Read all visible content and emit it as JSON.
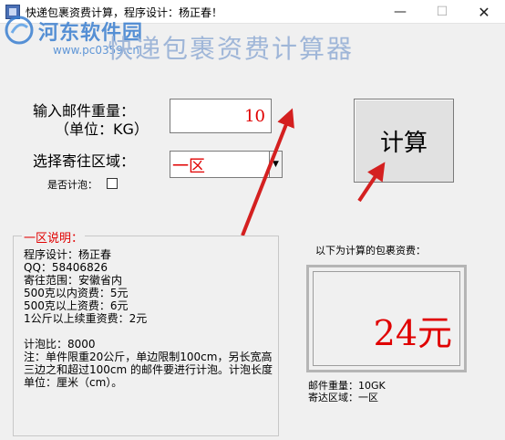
{
  "window": {
    "title": "快递包裹资费计算，程序设计：杨正春！",
    "minimize": "—",
    "maximize": "☐",
    "close": "✕"
  },
  "watermark": {
    "site": "河东软件园",
    "url": "www.pc0359.cn"
  },
  "app": {
    "heading": "快递包裹资费计算器"
  },
  "form": {
    "weight_label": "输入邮件重量：",
    "unit_label": "（单位：KG）",
    "weight_value": "10",
    "region_label": "选择寄往区域：",
    "region_value": "一区",
    "foam_label": "是否计泡：",
    "foam_checked": false
  },
  "calc_button": "计算",
  "info": {
    "title": "一区说明：",
    "lines": [
      "程序设计：杨正春",
      "QQ：58406826",
      "寄往范围：安徽省内",
      "500克以内资费：5元",
      "500克以上资费：6元",
      "1公斤以上续重资费：2元",
      "",
      "计泡比：8000",
      "注：单件限重20公斤，单边限制100cm，另长宽高三边之和超过100cm 的邮件要进行计泡。计泡长度单位：厘米（cm）。"
    ]
  },
  "result": {
    "caption": "以下为计算的包裹资费：",
    "value": "24元",
    "weight_line": "邮件重量：10GK",
    "region_line": "寄达区域：一区"
  },
  "colors": {
    "accent_red": "#e00000",
    "arrow_red": "#d42020",
    "heading_blue": "#9fb6d8",
    "watermark_blue": "#3a7fd0"
  }
}
